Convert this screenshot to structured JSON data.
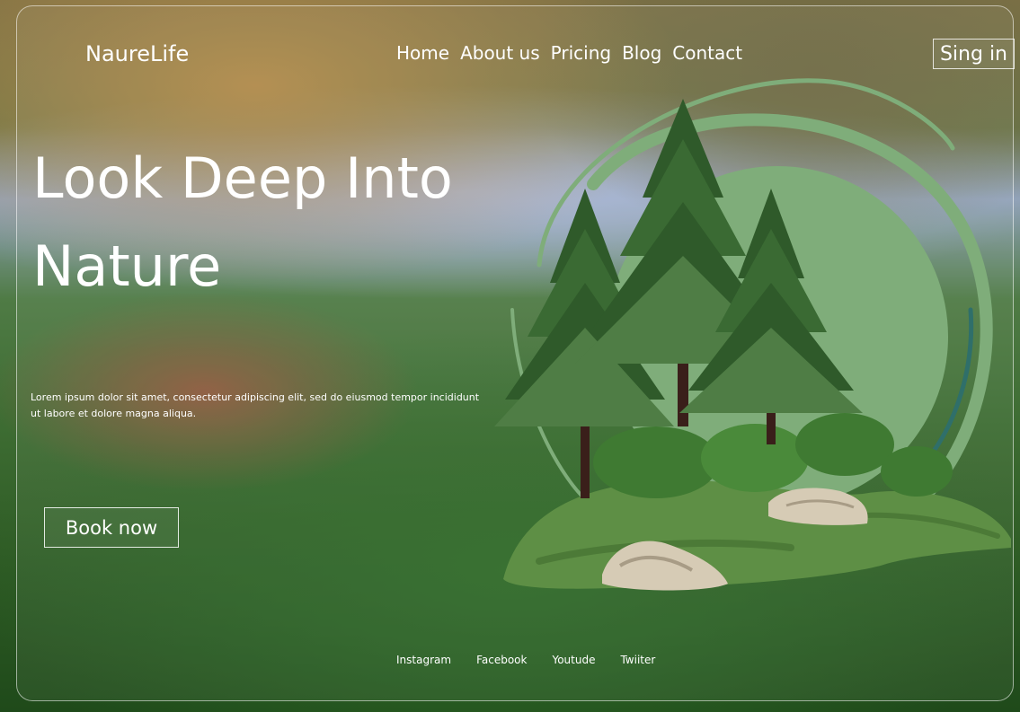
{
  "header": {
    "logo": "NaureLife",
    "nav": [
      "Home",
      "About us",
      "Pricing",
      "Blog",
      "Contact"
    ],
    "signin_label": "Sing in"
  },
  "hero": {
    "title_line1": "Look Deep Into",
    "title_line2": "Nature",
    "text": "Lorem ipsum dolor sit amet, consectetur adipiscing elit, sed do eiusmod tempor incididunt ut labore et dolore magna aliqua.",
    "cta_label": "Book now"
  },
  "footer": {
    "links": [
      "Instagram",
      "Facebook",
      "Youtude",
      "Twiiter"
    ]
  },
  "colors": {
    "circle": "#7fad7a",
    "tree_dark": "#2f5a2a",
    "tree_light": "#4f7d45",
    "grass": "#5e8f45",
    "rock": "#d6cbb5"
  }
}
